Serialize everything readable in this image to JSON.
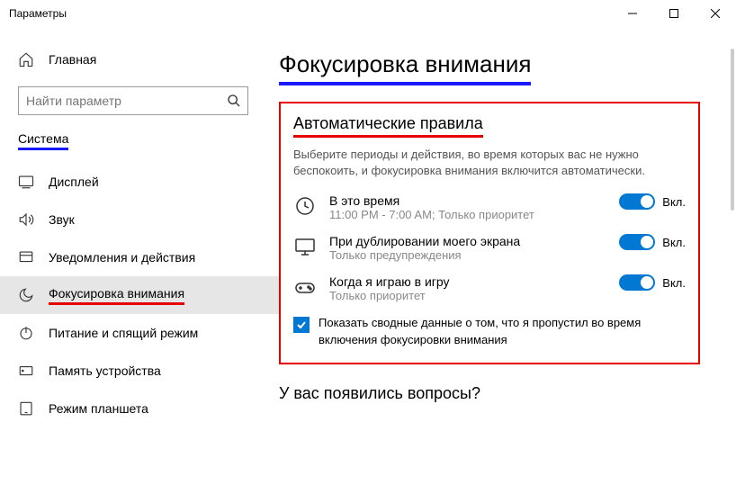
{
  "window": {
    "title": "Параметры"
  },
  "sidebar": {
    "home": "Главная",
    "search_placeholder": "Найти параметр",
    "category": "Система",
    "items": [
      {
        "label": "Дисплей"
      },
      {
        "label": "Звук"
      },
      {
        "label": "Уведомления и действия"
      },
      {
        "label": "Фокусировка внимания"
      },
      {
        "label": "Питание и спящий режим"
      },
      {
        "label": "Память устройства"
      },
      {
        "label": "Режим планшета"
      }
    ]
  },
  "main": {
    "title": "Фокусировка внимания",
    "section_title": "Автоматические правила",
    "description": "Выберите периоды и действия, во время которых вас не нужно беспокоить, и фокусировка внимания включится автоматически.",
    "rules": [
      {
        "title": "В это время",
        "sub": "11:00 PM - 7:00 AM; Только приоритет",
        "state": "Вкл."
      },
      {
        "title": "При дублировании моего экрана",
        "sub": "Только предупреждения",
        "state": "Вкл."
      },
      {
        "title": "Когда я играю в игру",
        "sub": "Только приоритет",
        "state": "Вкл."
      }
    ],
    "checkbox_text": "Показать сводные данные о том, что я пропустил во время включения фокусировки внимания",
    "questions": "У вас появились вопросы?"
  }
}
